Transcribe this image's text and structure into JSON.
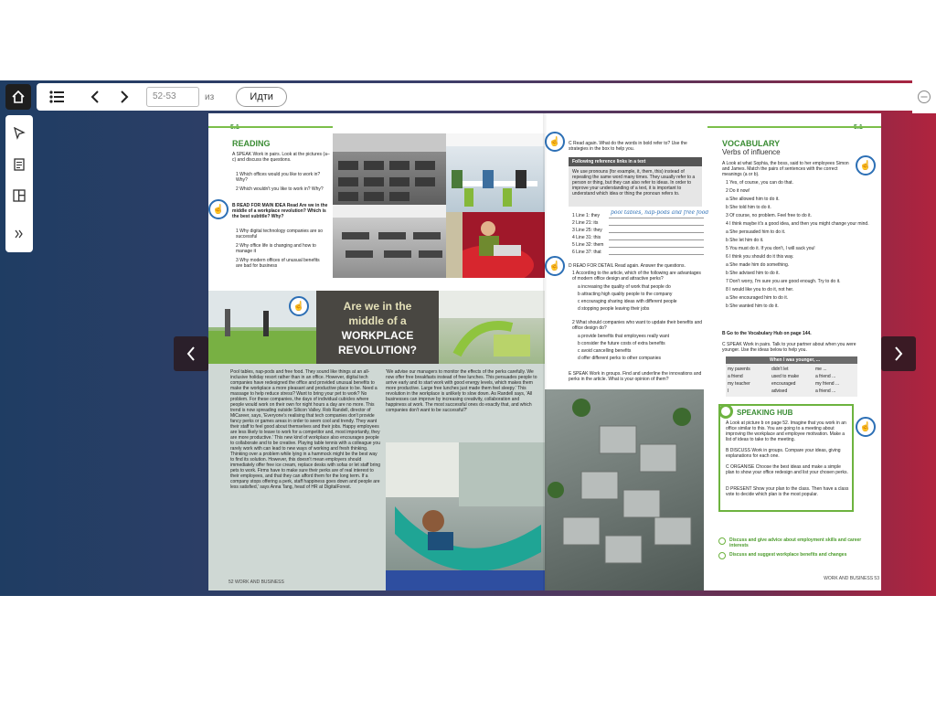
{
  "toolbar": {
    "page_value": "52-53",
    "of_label": "из",
    "go_label": "Идти"
  },
  "left_page": {
    "unit_tag": "5.1",
    "reading_title": "READING",
    "a_text": "A  SPEAK  Work in pairs. Look at the pictures (a–c) and discuss the questions.",
    "a_q1": "1  Which offices would you like to work in? Why?",
    "a_q2": "2  Which wouldn't you like to work in? Why?",
    "b_text": "B  READ FOR MAIN IDEA  Read Are we in the middle of a workplace revolution? Which is the best subtitle? Why?",
    "b_q1": "1  Why digital technology companies are so successful",
    "b_q2": "2  Why office life is changing and how to manage it",
    "b_q3": "3  Why modern offices of unusual benefits are bad for business",
    "headline_1": "Are we in the",
    "headline_2": "middle of a",
    "headline_3": "WORKPLACE",
    "headline_4": "REVOLUTION?",
    "col1": "Pool tables, nap-pods and free food. They sound like things at an all-inclusive holiday resort rather than in an office. However, digital tech companies have redesigned the office and provided unusual benefits to make the workplace a more pleasant and productive place to be. Need a massage to help reduce stress? Want to bring your pet to work? No problem. For these companies, the days of individual cubicles where people would work on their own for night hours a day are no more. This trend is now spreading outside Silicon Valley. Rob Randell, director of MiCareer, says, 'Everyone's realising that tech companies don't provide fancy perks or games areas in order to seem cool and trendy. They want their staff to feel good about themselves and their jobs. Happy employees are less likely to leave to work for a competitor and, most importantly, they are more productive.' This new kind of workplace also encourages people to collaborate and to be creative. Playing table tennis with a colleague you rarely work with can lead to new ways of working and fresh thinking. Thinking over a problem while lying in a hammock might be the best way to find its solution. However, this doesn't mean employers should immediately offer free ice cream, replace desks with sofas or let staff bring pets to work. Firms have to make sure their perks are of real interest to their employees, and that they can afford them for the long term. If a company stops offering a perk, staff happiness goes down and people are less satisfied,' says Anna Tang, head of HR at DigitalForest.",
    "col2": "'We advise our managers to monitor the effects of the perks carefully. We now offer free breakfasts instead of free lunches. This persuades people to arrive early and to start work with good energy levels, which makes them more productive. Large free lunches just made them feel sleepy.' This revolution in the workplace is unlikely to slow down. As Randell says, 'All businesses can improve by increasing creativity, collaboration and happiness at work. The most successful ones do exactly that, and which companies don't want to be successful?'",
    "footer": "52   WORK AND BUSINESS"
  },
  "right_page": {
    "unit_tag": "5.1",
    "c_text": "C  Read again. What do the words in bold refer to? Use the strategies in the box to help you.",
    "box_title": "Following reference links in a text",
    "box_body": "We use pronouns (for example, it, them, this) instead of repeating the same word many times. They usually refer to a person or thing, but they can also refer to ideas. In order to improve your understanding of a text, it is important to understand which idea or thing the pronoun refers to.",
    "lines": [
      "1  Line 1: they",
      "2  Line 21: its",
      "3  Line 25: they",
      "4  Line 31: this",
      "5  Line 32: them",
      "6  Line 37: that"
    ],
    "handwritten": "pool tables, nap-pods and free food",
    "d_text": "D  READ FOR DETAIL  Read again. Answer the questions.",
    "d_q1": "1  According to the article, which of the following are advantages of modern office design and attractive perks?",
    "d_opts1": [
      "a  increasing the quality of work that people do",
      "b  attracting high quality people to the company",
      "c  encouraging sharing ideas with different people",
      "d  stopping people leaving their jobs"
    ],
    "d_q2": "2  What should companies who want to update their benefits and office design do?",
    "d_opts2": [
      "a  provide benefits that employees really want",
      "b  consider the future costs of extra benefits",
      "c  avoid cancelling benefits",
      "d  offer different perks to other companies"
    ],
    "e_text": "E  SPEAK  Work in groups. Find and underline the innovations and perks in the article. What is your opinion of them?",
    "vocab_title": "VOCABULARY",
    "vocab_sub": "Verbs of influence",
    "vocab_a": "A  Look at what Sophia, the boss, said to her employees Simon and James. Match the pairs of sentences with the correct meanings (a or b).",
    "vocab_items": [
      "1  Yes, of course, you can do that.",
      "a  She allowed him to do it.",
      "b  She let him do it.",
      "2  Do it now!",
      "a  She allowed him to do it.",
      "b  She told him to do it.",
      "3  Of course, no problem. Feel free to do it.",
      "4  I think maybe it's a good idea, and then you might change your mind.",
      "a  She persuaded him to do it.",
      "b  She let him do it.",
      "5  You must do it. If you don't, I will sack you!",
      "6  I think you should do it this way.",
      "a  She made him do something.",
      "b  She advised him to do it.",
      "7  Don't worry, I'm sure you are good enough. Try to do it.",
      "8  I would like you to do it, not her.",
      "a  She encouraged him to do it.",
      "b  She wanted him to do it."
    ],
    "vocab_b": "B  Go to the Vocabulary Hub on page 144.",
    "vocab_c": "C  SPEAK  Work in pairs. Talk to your partner about when you were younger. Use the ideas below to help you.",
    "table_header": "When I was younger, ...",
    "table_rows": [
      [
        "my parents",
        "didn't let",
        "me ..."
      ],
      [
        "a friend",
        "used to make",
        "a friend ..."
      ],
      [
        "my teacher",
        "encouraged",
        "my friend ..."
      ],
      [
        "I",
        "advised",
        "a friend ..."
      ]
    ],
    "hub_title": "SPEAKING HUB",
    "hub_a": "A  Look at picture b on page 52. Imagine that you work in an office similar to this. You are going to a meeting about improving the workplace and employee motivation. Make a list of ideas to take to the meeting.",
    "hub_b": "B  DISCUSS  Work in groups. Compare your ideas, giving explanations for each one.",
    "hub_c": "C  ORGANISE  Choose the best ideas and make a simple plan to show your office redesign and list your chosen perks.",
    "hub_d": "D  PRESENT  Show your plan to the class. Then have a class vote to decide which plan is the most popular.",
    "goal_1": "Discuss and give advice about employment skills and career interests",
    "goal_2": "Discuss and suggest workplace benefits and changes",
    "footer": "WORK AND BUSINESS   53"
  }
}
